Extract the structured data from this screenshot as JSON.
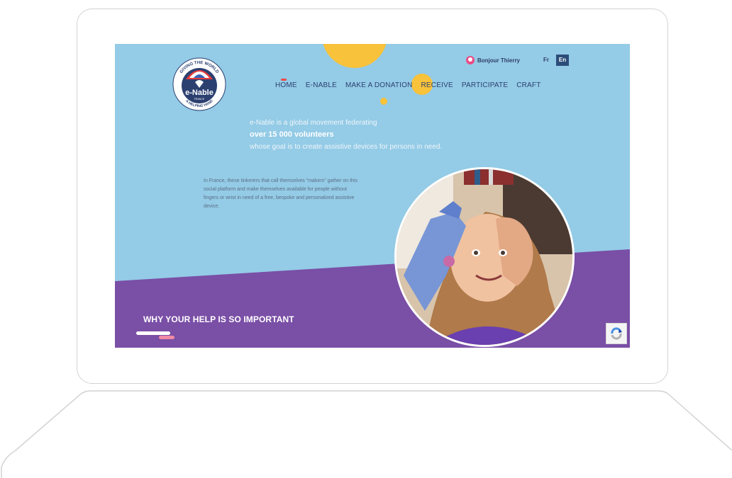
{
  "header": {
    "greeting": "Bonjour Thierry",
    "lang_fr": "Fr",
    "lang_en": "En"
  },
  "logo": {
    "brand": "e-Nable",
    "country": "FRANCE",
    "ring_top": "GIVING THE WORLD",
    "ring_bottom": "A HELPING HAND"
  },
  "nav": {
    "items": [
      "HOME",
      "E-NABLE",
      "MAKE A DONATION",
      "RECEIVE",
      "PARTICIPATE",
      "CRAFT"
    ]
  },
  "intro": {
    "line1": "e-Nable is a global movement federating",
    "line2": "over 15 000 volunteers",
    "line3": "whose goal is to create assistive devices for persons in need."
  },
  "body": {
    "text": "In France, these tinkerers that call themselves \"makers\" gather on this social platform and make themselves available for people without fingers or wrist in need of a free, bespoke and personalized assistive device."
  },
  "section": {
    "title": "WHY YOUR HELP IS SO IMPORTANT"
  },
  "colors": {
    "sky": "#94cbe6",
    "purple": "#7a4fa6",
    "yellow": "#f8c23a",
    "navy": "#2c4070",
    "pink": "#e94b86"
  }
}
